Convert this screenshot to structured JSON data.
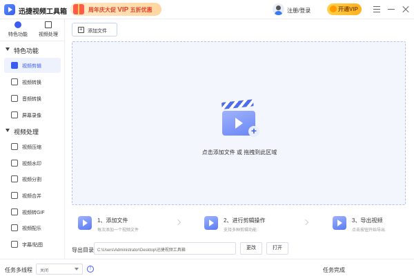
{
  "app": {
    "title": "迅捷视频工具箱",
    "promo_prefix": "周年庆大促",
    "promo_vip": "VIP",
    "promo_suffix": "五折优惠",
    "login": "注册/登录",
    "vip_button": "开通VIP"
  },
  "sidebar": {
    "tabs": [
      {
        "label": "特色功能",
        "icon": "star-icon"
      },
      {
        "label": "视频处理",
        "icon": "video-icon"
      }
    ],
    "groups": [
      {
        "label": "特色功能",
        "items": [
          {
            "label": "视频剪辑",
            "active": true
          },
          {
            "label": "视频转换"
          },
          {
            "label": "音频转换"
          },
          {
            "label": "屏幕录像"
          }
        ]
      },
      {
        "label": "视频处理",
        "items": [
          {
            "label": "视频压缩"
          },
          {
            "label": "视频水印"
          },
          {
            "label": "视频分割"
          },
          {
            "label": "视频合并"
          },
          {
            "label": "视频转GIF"
          },
          {
            "label": "视频配乐"
          },
          {
            "label": "字幕/贴图"
          }
        ]
      }
    ]
  },
  "main": {
    "add_file_button": "添加文件",
    "drop_hint": "点击添加文件 或 拖拽到此区域",
    "steps": [
      {
        "title": "1、添加文件",
        "desc": "每次添加一个视频文件"
      },
      {
        "title": "2、进行剪辑操作",
        "desc": "支持多种剪辑功能"
      },
      {
        "title": "3、导出视频",
        "desc": "点击按钮开始导出"
      }
    ],
    "output": {
      "label": "导出目录",
      "path": "C:\\Users\\Administrator\\Desktop\\迅捷视频工具箱",
      "change_button": "更改",
      "open_button": "打开"
    }
  },
  "bottom": {
    "multithread_label": "任务多线程",
    "multithread_value": "关闭",
    "right_text": "任务完成"
  },
  "colors": {
    "accent": "#3a5cf0",
    "vip": "#ffb020",
    "promo_text": "#e0452c"
  }
}
